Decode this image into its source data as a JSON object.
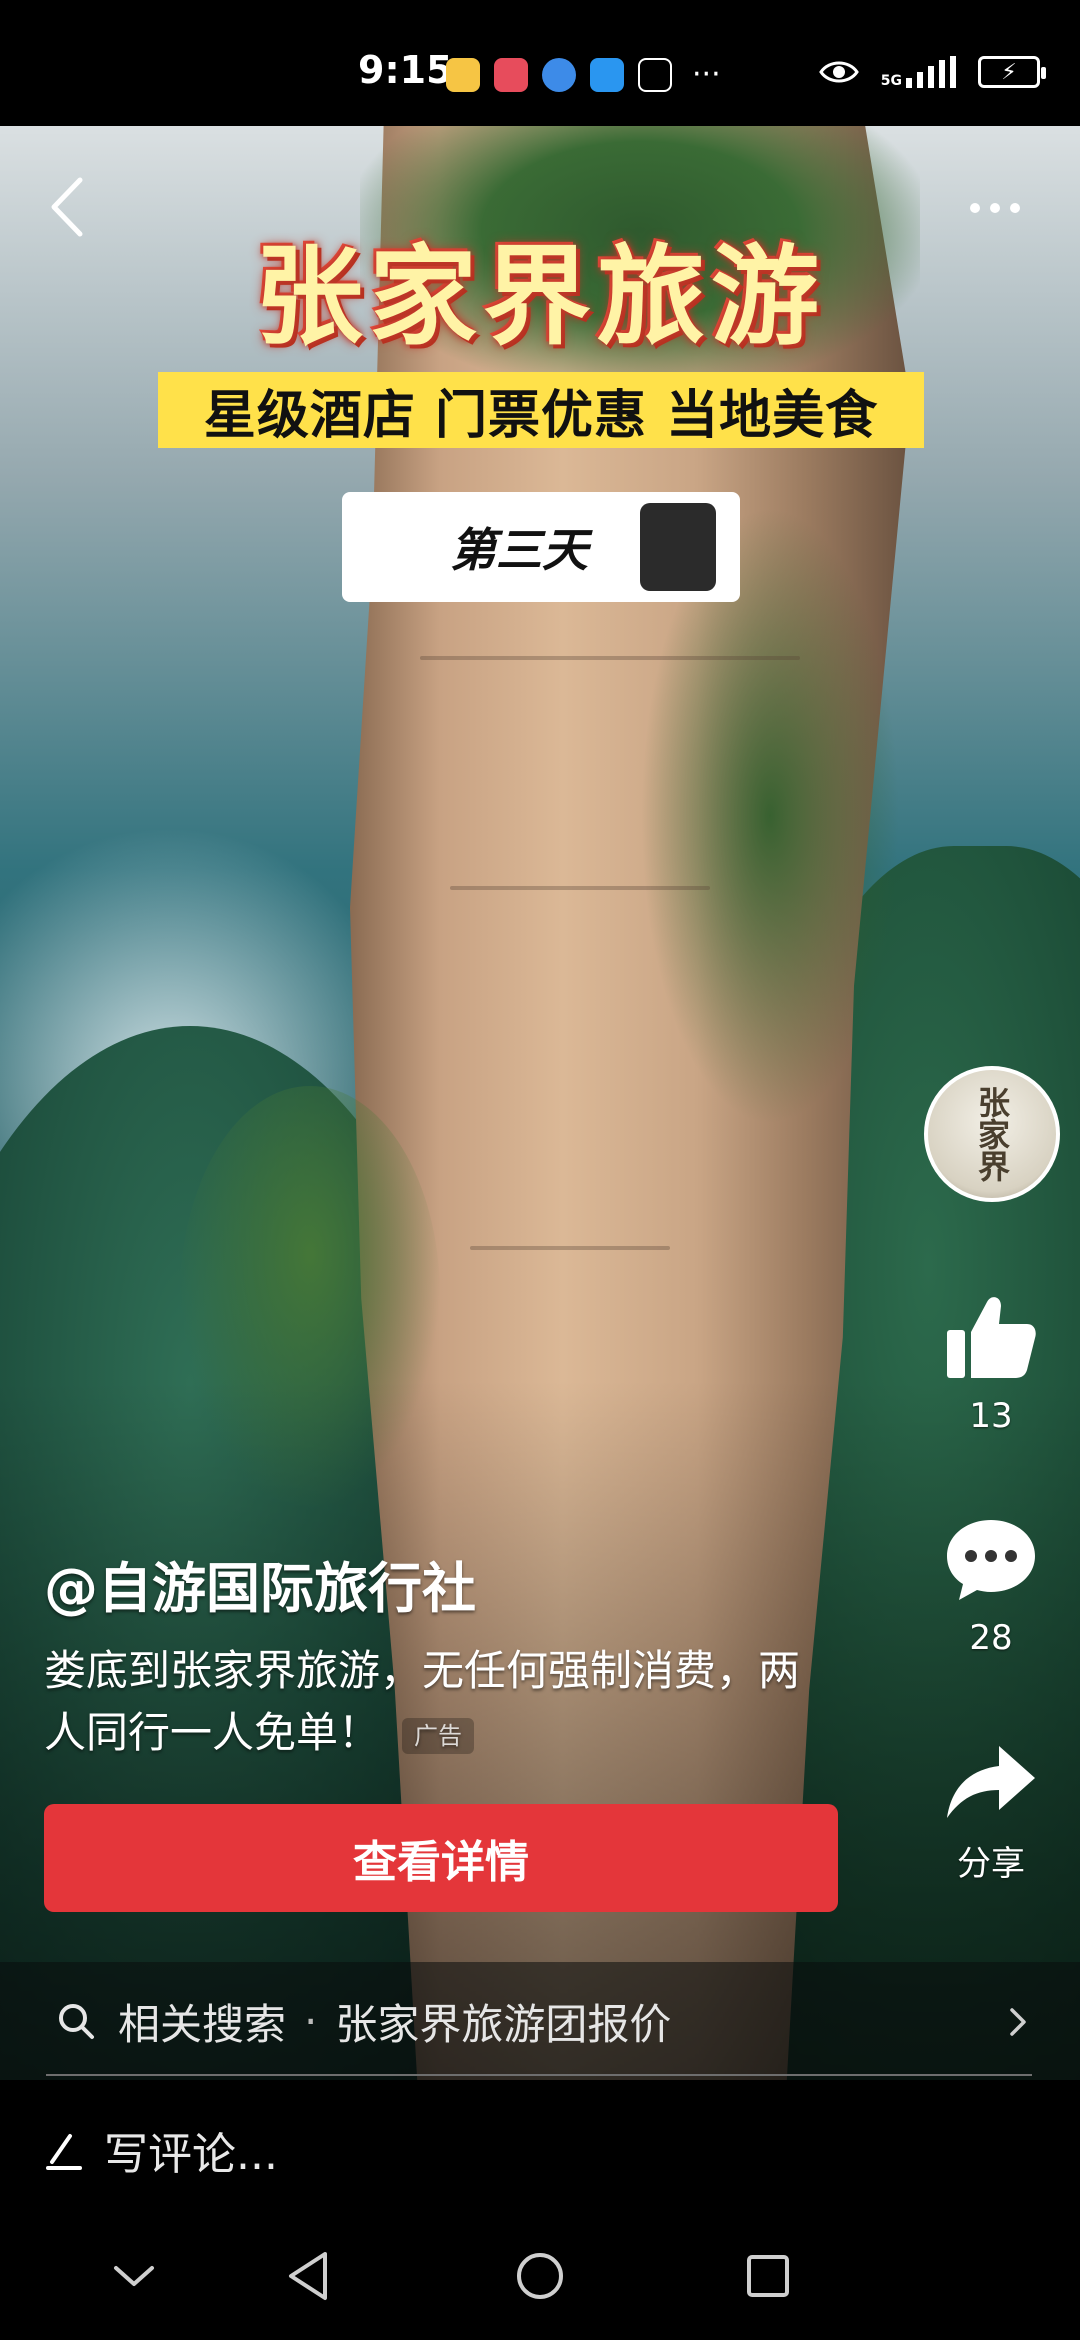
{
  "status_bar": {
    "time": "9:15",
    "network_label": "5G",
    "battery_icon": "battery-charging-icon",
    "more_apps": "···"
  },
  "video": {
    "headline": "张家界旅游",
    "subheadline": "星级酒店 门票优惠 当地美食",
    "day_label": "第三天"
  },
  "actions": {
    "avatar_text": "张家界",
    "like_count": "13",
    "comment_count": "28",
    "share_label": "分享"
  },
  "caption": {
    "author": "@自游国际旅行社",
    "description": "娄底到张家界旅游，无任何强制消费，两人同行一人免单！",
    "ad_tag": "广告",
    "cta_label": "查看详情"
  },
  "related_search": {
    "prefix": "相关搜索",
    "separator": "·",
    "query": "张家界旅游团报价"
  },
  "comment": {
    "placeholder": "写评论..."
  },
  "colors": {
    "cta": "#e4363a",
    "headline_band": "#ffe14a",
    "headline_text": "#fff3a6"
  }
}
